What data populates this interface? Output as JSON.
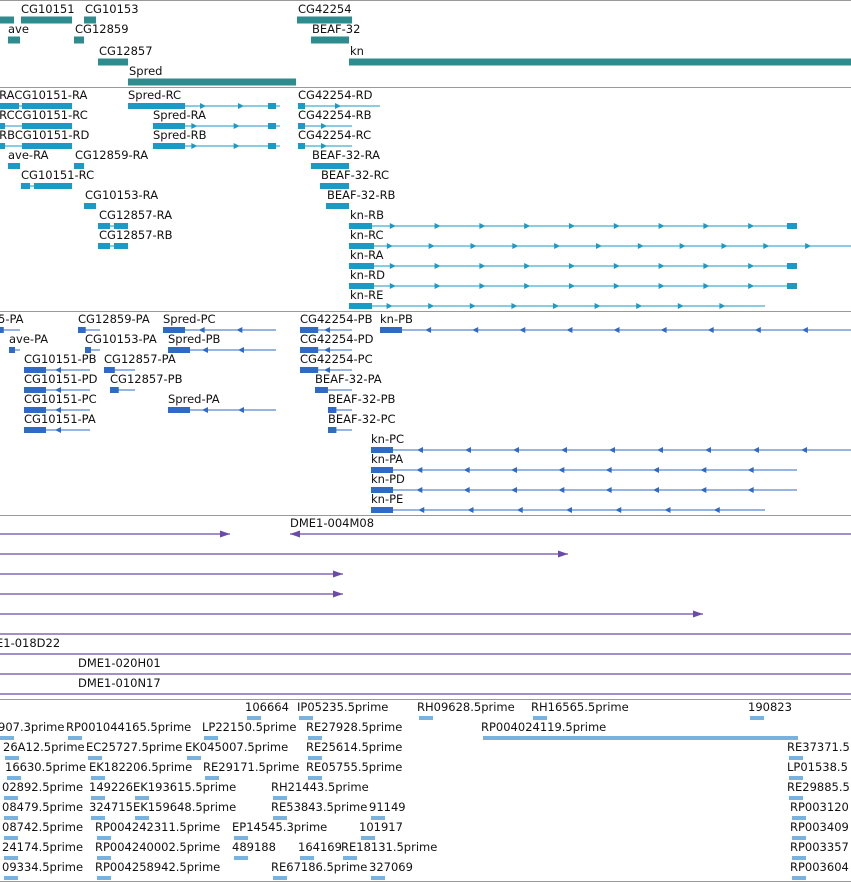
{
  "colors": {
    "gene": "#2e8b8e",
    "mrna": "#1a9ac4",
    "protein": "#2f6bc4",
    "clone": "#6b4ba8",
    "est": "#78b3df",
    "divider": "#999999"
  },
  "tracks": {
    "genes": [
      {
        "label": "CG10151",
        "strand": "+",
        "blocks": [
          [
            -5,
            14
          ],
          [
            21,
            72
          ]
        ],
        "labelAnchor": 21
      },
      {
        "label": "CG10153",
        "strand": "+",
        "blocks": [
          [
            84,
            96
          ]
        ],
        "labelAnchor": 85
      },
      {
        "label": "CG42254",
        "strand": "+",
        "blocks": [
          [
            297,
            352
          ]
        ],
        "labelAnchor": 298
      },
      {
        "label": "ave",
        "strand": "+",
        "blocks": [
          [
            8,
            20
          ]
        ],
        "labelAnchor": 8
      },
      {
        "label": "CG12859",
        "strand": "+",
        "blocks": [
          [
            74,
            84
          ]
        ],
        "labelAnchor": 75
      },
      {
        "label": "BEAF-32",
        "strand": "+",
        "blocks": [
          [
            311,
            349
          ]
        ],
        "labelAnchor": 312
      },
      {
        "label": "CG12857",
        "strand": "+",
        "blocks": [
          [
            98,
            128
          ]
        ],
        "labelAnchor": 99
      },
      {
        "label": "kn",
        "strand": "+",
        "blocks": [
          [
            349,
            851
          ]
        ],
        "labelAnchor": 350
      },
      {
        "label": "Spred",
        "strand": "+",
        "blocks": [
          [
            128,
            296
          ]
        ],
        "labelAnchor": 129
      }
    ],
    "mrnas": [
      {
        "label": "-RACG10151-RA",
        "labelAnchor": -5,
        "line": [
          -5,
          72
        ],
        "blocks": [
          [
            -5,
            19
          ],
          [
            22,
            72
          ]
        ]
      },
      {
        "label": "Spred-RC",
        "labelAnchor": 128,
        "line": [
          128,
          280
        ],
        "blocks": [
          [
            128,
            185
          ],
          [
            268,
            276
          ]
        ]
      },
      {
        "label": "CG42254-RD",
        "labelAnchor": 298,
        "line": [
          298,
          380
        ],
        "blocks": [
          [
            298,
            305
          ]
        ]
      },
      {
        "label": "-RCCG10151-RC",
        "labelAnchor": -5,
        "line": [
          -5,
          72
        ],
        "blocks": [
          [
            -5,
            5
          ],
          [
            22,
            72
          ]
        ]
      },
      {
        "label": "Spred-RA",
        "labelAnchor": 153,
        "line": [
          153,
          280
        ],
        "blocks": [
          [
            153,
            185
          ],
          [
            268,
            276
          ]
        ]
      },
      {
        "label": "CG42254-RB",
        "labelAnchor": 298,
        "line": [
          298,
          352
        ],
        "blocks": [
          [
            298,
            305
          ]
        ]
      },
      {
        "label": "-RBCG10151-RD",
        "labelAnchor": -5,
        "line": [
          -5,
          72
        ],
        "blocks": [
          [
            -5,
            5
          ],
          [
            22,
            72
          ]
        ]
      },
      {
        "label": "Spred-RB",
        "labelAnchor": 153,
        "line": [
          153,
          280
        ],
        "blocks": [
          [
            153,
            185
          ],
          [
            268,
            276
          ]
        ]
      },
      {
        "label": "CG42254-RC",
        "labelAnchor": 298,
        "line": [
          298,
          352
        ],
        "blocks": [
          [
            298,
            305
          ]
        ]
      },
      {
        "label": "ave-RA",
        "labelAnchor": 8,
        "line": [
          8,
          20
        ],
        "blocks": [
          [
            8,
            20
          ]
        ]
      },
      {
        "label": "CG12859-RA",
        "labelAnchor": 75,
        "line": [
          74,
          84
        ],
        "blocks": [
          [
            74,
            84
          ]
        ]
      },
      {
        "label": "BEAF-32-RA",
        "labelAnchor": 312,
        "line": [
          311,
          349
        ],
        "blocks": [
          [
            311,
            349
          ]
        ]
      },
      {
        "label": "CG10151-RC",
        "labelAnchor": 21,
        "line": [
          21,
          72
        ],
        "blocks": [
          [
            21,
            30
          ],
          [
            34,
            72
          ]
        ]
      },
      {
        "label": "BEAF-32-RC",
        "labelAnchor": 321,
        "line": [
          320,
          349
        ],
        "blocks": [
          [
            320,
            349
          ]
        ]
      },
      {
        "label": "CG10153-RA",
        "labelAnchor": 85,
        "line": [
          84,
          96
        ],
        "blocks": [
          [
            84,
            96
          ]
        ]
      },
      {
        "label": "BEAF-32-RB",
        "labelAnchor": 327,
        "line": [
          326,
          349
        ],
        "blocks": [
          [
            326,
            349
          ]
        ]
      },
      {
        "label": "CG12857-RA",
        "labelAnchor": 99,
        "line": [
          98,
          128
        ],
        "blocks": [
          [
            98,
            110
          ],
          [
            114,
            128
          ]
        ]
      },
      {
        "label": "kn-RB",
        "labelAnchor": 350,
        "line": [
          349,
          797
        ],
        "blocks": [
          [
            349,
            372
          ],
          [
            787,
            797
          ]
        ]
      },
      {
        "label": "CG12857-RB",
        "labelAnchor": 99,
        "line": [
          98,
          128
        ],
        "blocks": [
          [
            98,
            110
          ],
          [
            114,
            128
          ]
        ]
      },
      {
        "label": "kn-RC",
        "labelAnchor": 350,
        "line": [
          349,
          851
        ],
        "blocks": [
          [
            349,
            374
          ]
        ]
      },
      {
        "label": "kn-RA",
        "labelAnchor": 350,
        "line": [
          349,
          797
        ],
        "blocks": [
          [
            349,
            374
          ],
          [
            787,
            797
          ]
        ]
      },
      {
        "label": "kn-RD",
        "labelAnchor": 350,
        "line": [
          349,
          797
        ],
        "blocks": [
          [
            349,
            374
          ],
          [
            787,
            797
          ]
        ]
      },
      {
        "label": "kn-RE",
        "labelAnchor": 350,
        "line": [
          349,
          765
        ],
        "blocks": [
          [
            349,
            372
          ]
        ]
      }
    ],
    "proteins": [
      {
        "label": "5-PA",
        "labelAnchor": -2
      },
      {
        "label": "CG12859-PA",
        "labelAnchor": 78
      },
      {
        "label": "Spred-PC",
        "labelAnchor": 163
      },
      {
        "label": "CG42254-PB",
        "labelAnchor": 300
      },
      {
        "label": "kn-PB",
        "labelAnchor": 380
      },
      {
        "label": "ave-PA",
        "labelAnchor": 9
      },
      {
        "label": "CG10153-PA",
        "labelAnchor": 85
      },
      {
        "label": "Spred-PB",
        "labelAnchor": 168
      },
      {
        "label": "CG42254-PD",
        "labelAnchor": 300
      },
      {
        "label": "CG10151-PB",
        "labelAnchor": 24
      },
      {
        "label": "CG12857-PA",
        "labelAnchor": 104
      },
      {
        "label": "CG42254-PC",
        "labelAnchor": 300
      },
      {
        "label": "CG10151-PD",
        "labelAnchor": 24
      },
      {
        "label": "CG12857-PB",
        "labelAnchor": 110
      },
      {
        "label": "BEAF-32-PA",
        "labelAnchor": 315
      },
      {
        "label": "CG10151-PC",
        "labelAnchor": 24
      },
      {
        "label": "Spred-PA",
        "labelAnchor": 168
      },
      {
        "label": "BEAF-32-PB",
        "labelAnchor": 328
      },
      {
        "label": "CG10151-PA",
        "labelAnchor": 24
      },
      {
        "label": "BEAF-32-PC",
        "labelAnchor": 328
      },
      {
        "label": "kn-PC",
        "labelAnchor": 371
      },
      {
        "label": "kn-PA",
        "labelAnchor": 371
      },
      {
        "label": "kn-PD",
        "labelAnchor": 371
      },
      {
        "label": "kn-PE",
        "labelAnchor": 371
      }
    ],
    "clones": [
      {
        "label": "DME1-004M08",
        "labelAnchor": 290
      },
      {
        "label": "E1-018D22",
        "labelAnchor": -4
      },
      {
        "label": "DME1-020H01",
        "labelAnchor": 78
      },
      {
        "label": "DME1-010N17",
        "labelAnchor": 78
      }
    ],
    "ests": [
      "106664",
      "IP05235.5prime",
      "RH09628.5prime",
      "RH16565.5prime",
      "190823",
      "907.3prime",
      "RP001044165.5prime",
      "LP22150.5prime",
      "RE27928.5prime",
      "RP004024119.5prime",
      "26A12.5prime",
      "EC25727.5prime",
      "EK045007.5prime",
      "RE25614.5prime",
      "RE37371.5",
      "16630.5prime",
      "EK182206.5prime",
      "RE29171.5prime",
      "RE05755.5prime",
      "LP01538.5",
      "02892.5prime",
      "149226",
      "EK193615.5prime",
      "RH21443.5prime",
      "RE29885.5",
      "08479.5prime",
      "324715",
      "EK159648.5prime",
      "RE53843.5prime",
      "91149",
      "RP003120",
      "08742.5prime",
      "RP004242311.5prime",
      "EP14545.3prime",
      "101917",
      "RP003409",
      "24174.5prime",
      "RP004240002.5prime",
      "489188",
      "164169",
      "RE18131.5prime",
      "RP003357",
      "09334.5prime",
      "RP004258942.5prime",
      "RE67186.5prime",
      "327069",
      "RP003604"
    ]
  }
}
